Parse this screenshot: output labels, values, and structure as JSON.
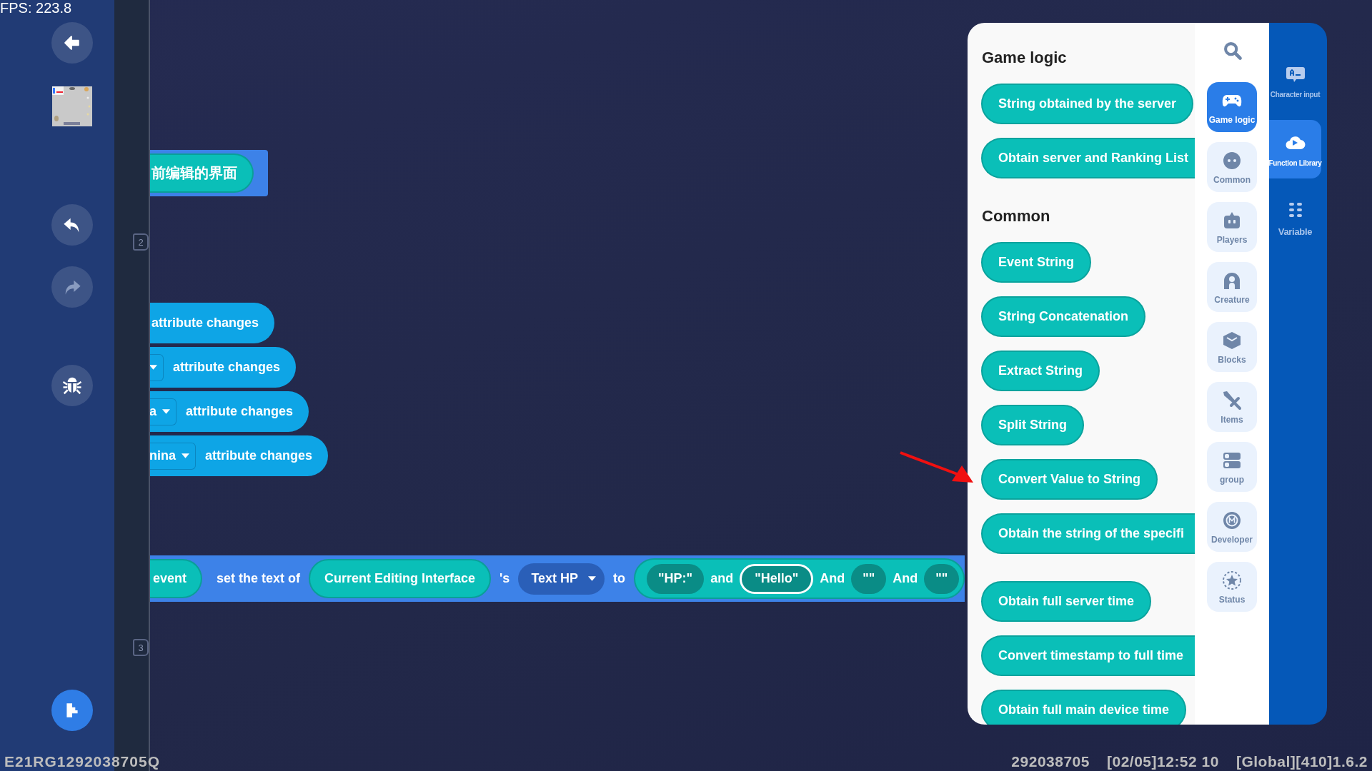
{
  "fps": "FPS: 223.8",
  "canvas": {
    "label_block": {
      "text": "前编辑的界面"
    },
    "event_blocks": [
      {
        "has_dropdown": false,
        "label": "attribute changes"
      },
      {
        "has_dropdown": true,
        "label": "attribute changes"
      },
      {
        "has_dropdown": true,
        "dropdown": "a",
        "label": "attribute changes"
      },
      {
        "has_dropdown": true,
        "dropdown": "nina",
        "label": "attribute changes"
      }
    ],
    "statement": [
      {
        "kind": "pill",
        "text": "event"
      },
      {
        "kind": "text",
        "text": "set the text of"
      },
      {
        "kind": "pill",
        "text": "Current Editing Interface"
      },
      {
        "kind": "text",
        "text": "'s"
      },
      {
        "kind": "dropdown",
        "text": "Text HP"
      },
      {
        "kind": "text",
        "text": "to"
      },
      {
        "kind": "group",
        "children": [
          {
            "kind": "string",
            "text": "\"HP:\"",
            "selected": false
          },
          {
            "kind": "text",
            "text": "and"
          },
          {
            "kind": "string",
            "text": "\"Hello\"",
            "selected": true
          },
          {
            "kind": "text",
            "text": "And"
          },
          {
            "kind": "string",
            "text": "\"\"",
            "selected": false
          },
          {
            "kind": "text",
            "text": "And"
          },
          {
            "kind": "string",
            "text": "\"\"",
            "selected": false
          }
        ]
      }
    ],
    "line_markers": [
      "2",
      "3"
    ]
  },
  "flyout": {
    "sections": [
      {
        "title": "Game logic",
        "blocks": [
          {
            "text": "String obtained by the server",
            "clipped": false
          },
          {
            "text": "Obtain server and Ranking List",
            "clipped": true
          }
        ]
      },
      {
        "title": "Common",
        "blocks": [
          {
            "text": "Event String",
            "clipped": false
          },
          {
            "text": "String Concatenation",
            "clipped": false
          },
          {
            "text": "Extract String",
            "clipped": false
          },
          {
            "text": "Split String",
            "clipped": false
          },
          {
            "text": "Convert Value to String",
            "clipped": false
          },
          {
            "text": "Obtain the string of the specifi",
            "clipped": true
          }
        ]
      },
      {
        "blocks": [
          {
            "text": "Obtain full server time",
            "clipped": false
          },
          {
            "text": "Convert timestamp to full time",
            "clipped": true
          },
          {
            "text": "Obtain full main device time",
            "clipped": false
          }
        ]
      }
    ]
  },
  "categories": [
    {
      "label": "Game logic",
      "selected": true
    },
    {
      "label": "Common",
      "selected": false
    },
    {
      "label": "Players",
      "selected": false
    },
    {
      "label": "Creature",
      "selected": false
    },
    {
      "label": "Blocks",
      "selected": false
    },
    {
      "label": "Items",
      "selected": false
    },
    {
      "label": "group",
      "selected": false
    },
    {
      "label": "Developer",
      "selected": false
    },
    {
      "label": "Status",
      "selected": false
    }
  ],
  "side_tabs": [
    {
      "label": "Character input",
      "selected": false
    },
    {
      "label": "Function Library",
      "selected": true
    },
    {
      "label": "Variable",
      "selected": false
    }
  ],
  "status_bar": {
    "device_id": "E21RG1292038705Q",
    "user_id": "292038705",
    "time": "[02/05]12:52 10",
    "version": "[Global][410]1.6.2"
  }
}
